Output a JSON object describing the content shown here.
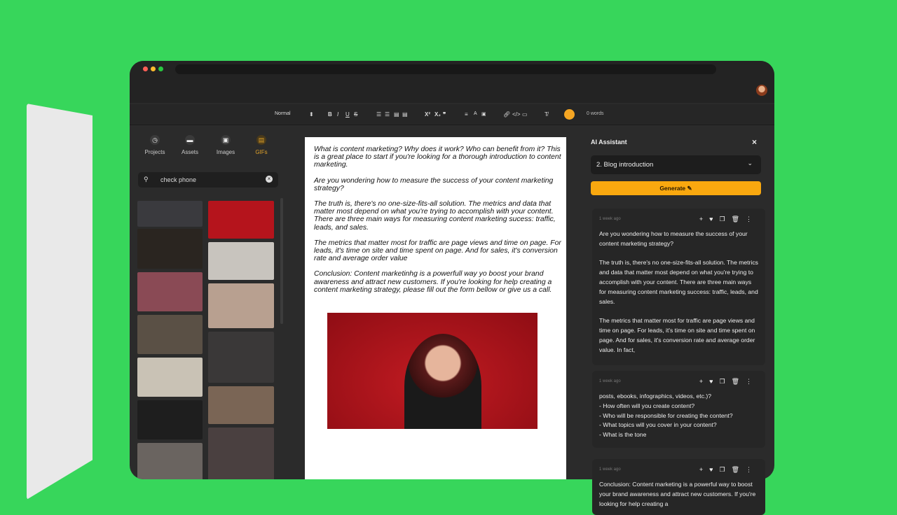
{
  "toolbar": {
    "style": "Normal",
    "icons": [
      "bold",
      "italic",
      "underline",
      "strike",
      "ordered-list",
      "bullet-list",
      "indent",
      "outdent",
      "superscript",
      "subscript",
      "quote",
      "align",
      "text-color",
      "highlight",
      "link",
      "code",
      "image",
      "clear-format",
      "ai"
    ],
    "word_count": "0 words"
  },
  "left_panel": {
    "tabs": [
      {
        "label": "Projects",
        "icon": "clock"
      },
      {
        "label": "Assets",
        "icon": "folder"
      },
      {
        "label": "Images",
        "icon": "image"
      },
      {
        "label": "GIFs",
        "icon": "gif",
        "active": true
      }
    ],
    "search_value": "check phone",
    "accent": "#e0a22a"
  },
  "editor": {
    "paragraphs": [
      "What is content marketing? Why does it work? Who can benefit from it? This is a great place to start if you're looking for a thorough introduction to content marketing.",
      "Are you wondering how to measure the success of your content marketing strategy?",
      "The truth is, there's no one-size-fits-all solution. The metrics and data that matter most depend on what you're trying to accomplish with your content. There are three main ways for measuring content marketing sucess: traffic, leads, and sales.",
      "The metrics that matter most for traffic are page views and time on page. For leads, it's time on site and time spent on page. And for sales, it's conversion rate and average order value",
      "Conclusion: Content marketinhg is a powerfull way yo boost your brand awareness and attract new customers. If you're looking for help creating a content marketing strategy, please fill out the form bellow or give us a call."
    ]
  },
  "ai": {
    "title": "AI Assistant",
    "template": "2. Blog introduction",
    "generate": "Generate",
    "accent": "#f9a80f",
    "cards": [
      {
        "time": "1 week ago",
        "text": "Are you wondering how to measure the success of your content marketing strategy?\n\nThe truth is, there's no one-size-fits-all solution. The metrics and data that matter most depend on what you're trying to accomplish with your content. There are three main ways for measuring content marketing success: traffic, leads, and sales.\n\nThe metrics that matter most for traffic are page views and time on page. For leads, it's time on site and time spent on page. And for sales, it's conversion rate and average order value. In fact,"
      },
      {
        "time": "1 week ago",
        "text": "posts, ebooks, infographics, videos, etc.)?\n- How often will you create content?\n- Who will be responsible for creating the content?\n- What topics will you cover in your content?\n- What is the tone"
      },
      {
        "time": "1 week ago",
        "text": "Conclusion: Content marketing is a powerful way to boost your brand awareness and attract new customers. If you're looking for help creating a"
      }
    ]
  }
}
